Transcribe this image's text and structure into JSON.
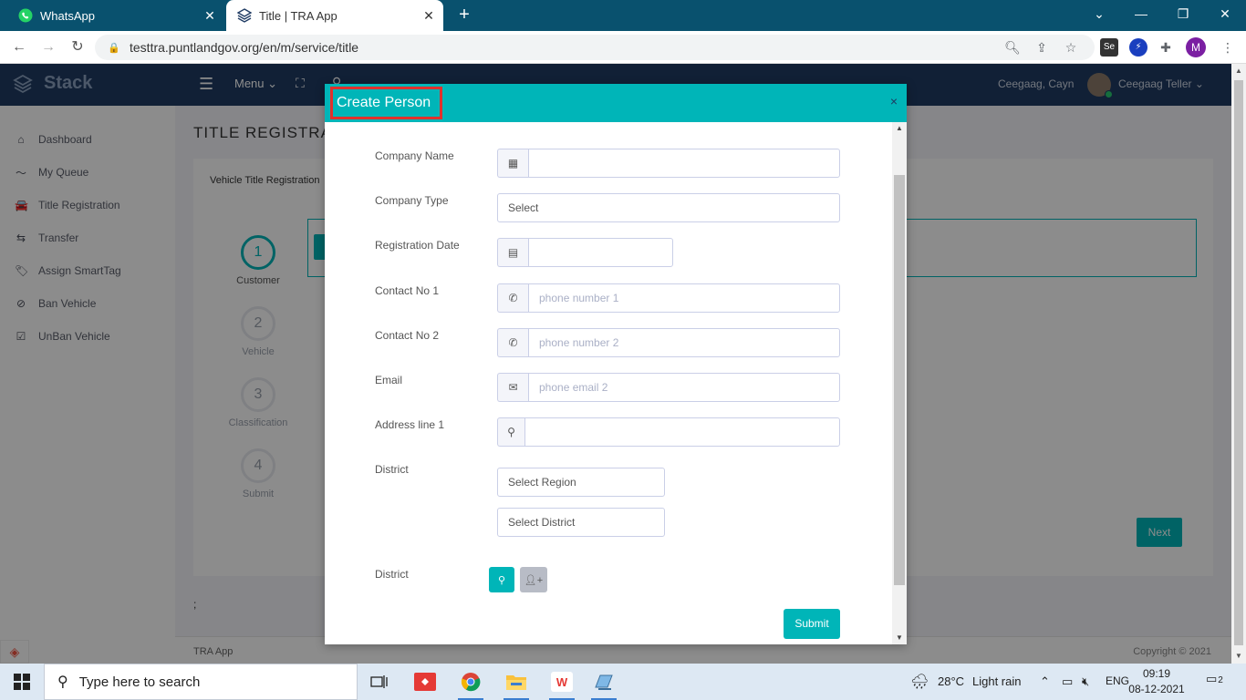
{
  "browser": {
    "tabs": [
      {
        "title": "WhatsApp",
        "icon": "whatsapp-icon",
        "active": false
      },
      {
        "title": "Title | TRA App",
        "icon": "stack-logo-icon",
        "active": true
      }
    ],
    "url": "testtra.puntlandgov.org/en/m/service/title",
    "profile_initial": "M",
    "extensions": [
      "Se"
    ]
  },
  "app": {
    "brand": "Stack",
    "menu_label": "Menu",
    "user_short": "Ceegaag, Cayn",
    "user_role": "Ceegaag Teller",
    "sidebar": [
      {
        "label": "Dashboard",
        "icon": "home-icon",
        "glyph": "⌂"
      },
      {
        "label": "My Queue",
        "icon": "trend-icon",
        "glyph": "〜"
      },
      {
        "label": "Title Registration",
        "icon": "car-icon",
        "glyph": "🚘"
      },
      {
        "label": "Transfer",
        "icon": "transfer-icon",
        "glyph": "⇆"
      },
      {
        "label": "Assign SmartTag",
        "icon": "tags-icon",
        "glyph": "🏷"
      },
      {
        "label": "Ban Vehicle",
        "icon": "ban-icon",
        "glyph": "⊘"
      },
      {
        "label": "UnBan Vehicle",
        "icon": "check-square-icon",
        "glyph": "☑"
      }
    ],
    "page_title": "TITLE REGISTRA",
    "card_subtitle": "Vehicle Title Registration",
    "steps": [
      {
        "number": "1",
        "label": "Customer"
      },
      {
        "number": "2",
        "label": "Vehicle"
      },
      {
        "number": "3",
        "label": "Classification"
      },
      {
        "number": "4",
        "label": "Submit"
      }
    ],
    "next_label": "Next",
    "semicolon": ";",
    "footer_left": "TRA App",
    "footer_right": "Copyright © 2021"
  },
  "modal": {
    "title": "Create Person",
    "close": "×",
    "fields": {
      "company_name": {
        "label": "Company Name",
        "value": ""
      },
      "company_type": {
        "label": "Company Type",
        "value": "Select"
      },
      "registration_date": {
        "label": "Registration Date",
        "value": ""
      },
      "contact1": {
        "label": "Contact No 1",
        "placeholder": "phone number 1"
      },
      "contact2": {
        "label": "Contact No 2",
        "placeholder": "phone number 2"
      },
      "email": {
        "label": "Email",
        "placeholder": "phone email 2"
      },
      "address": {
        "label": "Address line 1",
        "value": ""
      },
      "district": {
        "label": "District",
        "region": "Select Region",
        "district": "Select District"
      },
      "district2": {
        "label": "District"
      }
    },
    "submit_label": "Submit"
  },
  "taskbar": {
    "search_placeholder": "Type here to search",
    "weather_temp": "28°C",
    "weather_desc": "Light rain",
    "lang": "ENG",
    "time": "09:19",
    "date": "08-12-2021",
    "notifications": "2"
  },
  "colors": {
    "accent": "#00b5b8",
    "header": "#1f3b63",
    "highlight_border": "#e1312c"
  }
}
